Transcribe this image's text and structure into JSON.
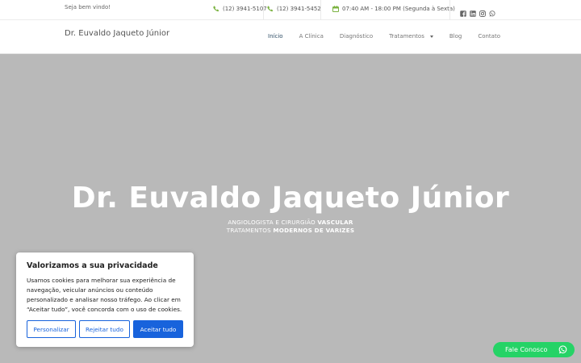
{
  "topbar": {
    "welcome": "Seja bem vindo!",
    "phone1": "(12) 3941-5107",
    "phone2": "(12) 3941-5452",
    "hours": "07:40 AM - 18:00 PM (Segunda à Sexta)",
    "social": [
      "facebook-icon",
      "linkedin-icon",
      "instagram-icon",
      "whatsapp-icon"
    ],
    "accent": "#7cb342"
  },
  "header": {
    "site_title": "Dr. Euvaldo Jaqueto Júnior",
    "nav": [
      {
        "label": "Início",
        "active": true
      },
      {
        "label": "A Clínica"
      },
      {
        "label": "Diagnóstico"
      },
      {
        "label": "Tratamentos",
        "dropdown": true
      },
      {
        "label": "Blog"
      },
      {
        "label": "Contato"
      }
    ]
  },
  "hero": {
    "title": "Dr. Euvaldo Jaqueto Júnior",
    "sub1_normal": "ANGIOLOGISTA E CIRURGIÃO ",
    "sub1_bold": "VASCULAR",
    "sub2_normal": "TRATAMENTOS ",
    "sub2_bold": "MODERNOS DE VARIZES",
    "background": "#b9b9b9"
  },
  "cookie": {
    "title": "Valorizamos a sua privacidade",
    "text": "Usamos cookies para melhorar sua experiência de navegação, veicular anúncios ou conteúdo personalizado e analisar nosso tráfego. Ao clicar em “Aceitar tudo”, você concorda com o uso de cookies.",
    "btn_customize": "Personalizar",
    "btn_reject": "Rejeitar tudo",
    "btn_accept": "Aceitar tudo",
    "accent": "#1863dc"
  },
  "whatsapp": {
    "label": "Fale Conosco",
    "color": "#25d366"
  }
}
